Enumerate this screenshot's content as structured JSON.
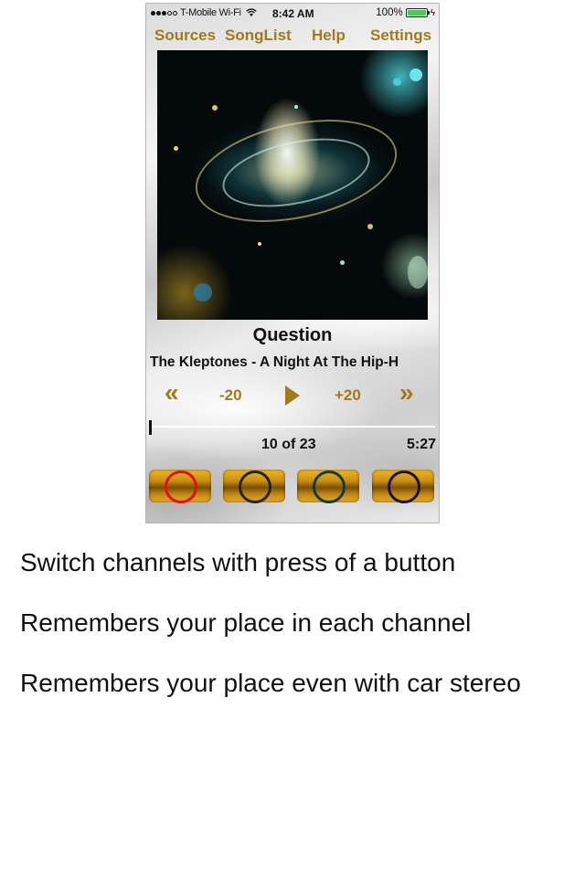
{
  "status_bar": {
    "carrier": "T-Mobile Wi-Fi",
    "time": "8:42 AM",
    "battery": "100%",
    "battery_level": 1.0
  },
  "nav": {
    "items": [
      {
        "label": "Sources"
      },
      {
        "label": "SongList"
      },
      {
        "label": "Help"
      },
      {
        "label": "Settings"
      }
    ]
  },
  "now_playing": {
    "title": "Question",
    "subtitle": "The Kleptones - A Night At The Hip-H",
    "track_index": "10 of 23",
    "duration": "5:27",
    "progress": 0.0
  },
  "controls": {
    "rewind_icon": "double-chevron-left-icon",
    "skip_back_label": "-20",
    "play_icon": "play-icon",
    "skip_forward_label": "+20",
    "fast_forward_icon": "double-chevron-right-icon"
  },
  "channels": [
    {
      "ring_color": "#e01010",
      "selected": true
    },
    {
      "ring_color": "#222222",
      "selected": false
    },
    {
      "ring_color": "#0e3b3b",
      "selected": false
    },
    {
      "ring_color": "#1a0f3a",
      "selected": false
    }
  ],
  "colors": {
    "accent_gold": "#a07a1c"
  },
  "features": [
    "Switch channels with press of a button",
    "Remembers your place in each channel",
    "Remembers your place even with car stereo"
  ]
}
